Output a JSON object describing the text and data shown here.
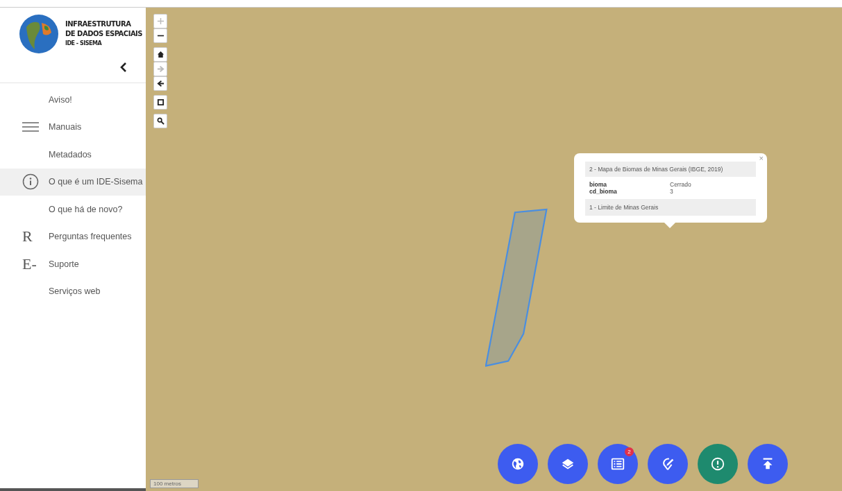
{
  "logo": {
    "lines": [
      "INFRAESTRUTURA",
      "DE DADOS ESPACIAIS",
      "IDE - SISEMA"
    ]
  },
  "menu": [
    {
      "label": "Aviso!",
      "kind": "plain",
      "selected": false
    },
    {
      "label": "Manuais",
      "kind": "menu",
      "selected": false
    },
    {
      "label": "Metadados",
      "kind": "plain",
      "selected": false
    },
    {
      "label": "O que é um IDE-Sisema",
      "kind": "info",
      "selected": true
    },
    {
      "label": "O que há de novo?",
      "kind": "plain",
      "selected": false
    },
    {
      "label": "Perguntas frequentes",
      "kind": "glyph",
      "glyph": "R",
      "selected": false
    },
    {
      "label": "Suporte",
      "kind": "glyph",
      "glyph": "E-",
      "selected": false
    },
    {
      "label": "Serviços web",
      "kind": "plain",
      "selected": false
    }
  ],
  "map_controls": [
    {
      "kind": "plus",
      "disabled": true
    },
    {
      "kind": "minus",
      "disabled": false
    },
    {
      "kind": "home",
      "disabled": false
    },
    {
      "kind": "forward",
      "disabled": true
    },
    {
      "kind": "back",
      "disabled": false
    },
    {
      "kind": "frame",
      "disabled": false
    },
    {
      "kind": "search",
      "disabled": false
    }
  ],
  "popup": {
    "title": "2 - Mapa de Biomas de Minas Gerais (IBGE, 2019)",
    "close": "×",
    "attributes": [
      {
        "name": "bioma",
        "value": "Cerrado"
      },
      {
        "name": "cd_bioma",
        "value": "3"
      }
    ],
    "footer": "1 - Limite de Minas Gerais"
  },
  "scale": "100 metros",
  "fab_buttons": [
    {
      "kind": "globe",
      "color": "#3d5cf0"
    },
    {
      "kind": "layers",
      "color": "#3d5cf0"
    },
    {
      "kind": "legend",
      "color": "#3d5cf0",
      "badge": "2"
    },
    {
      "kind": "pin-edit",
      "color": "#3d5cf0"
    },
    {
      "kind": "alert",
      "color": "#1e8a6e"
    },
    {
      "kind": "upload",
      "color": "#3d5cf0"
    }
  ]
}
